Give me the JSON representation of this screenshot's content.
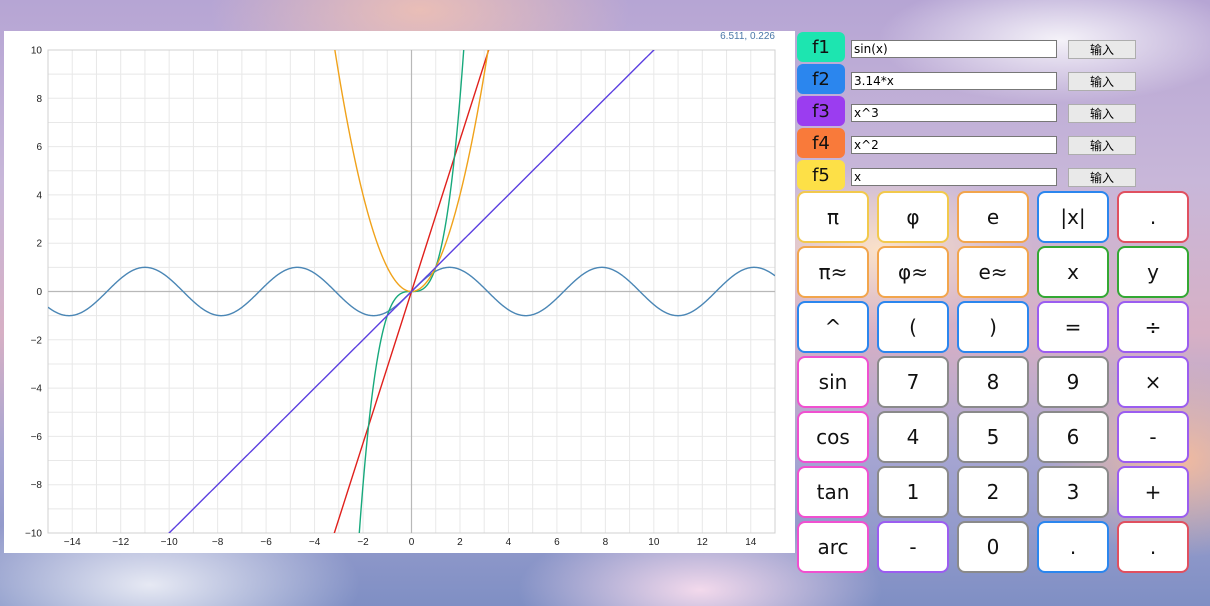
{
  "plot": {
    "coord_readout": "6.511, 0.226",
    "x_tick_labels": [
      "−14",
      "−12",
      "−10",
      "−8",
      "−6",
      "−4",
      "−2",
      "0",
      "2",
      "4",
      "6",
      "8",
      "10",
      "12",
      "14"
    ],
    "y_tick_labels": [
      "10",
      "8",
      "6",
      "4",
      "2",
      "0",
      "−2",
      "−4",
      "−6",
      "−8",
      "−10"
    ]
  },
  "chart_data": {
    "type": "line",
    "xlim": [
      -15,
      15
    ],
    "ylim": [
      -10,
      10
    ],
    "grid": true,
    "series": [
      {
        "expr": "sin(x)",
        "color": "#4a86b5"
      },
      {
        "expr": "3.14*x",
        "color": "#e0201c"
      },
      {
        "expr": "x^3",
        "color": "#17a97c"
      },
      {
        "expr": "x^2",
        "color": "#f0a21a"
      },
      {
        "expr": "x",
        "color": "#5b3fe0"
      }
    ]
  },
  "functions": [
    {
      "label": "f1",
      "value": "sin(x)",
      "button": "输入",
      "color": "#1de5b0"
    },
    {
      "label": "f2",
      "value": "3.14*x",
      "button": "输入",
      "color": "#2b86ee"
    },
    {
      "label": "f3",
      "value": "x^3",
      "button": "输入",
      "color": "#9b3df0"
    },
    {
      "label": "f4",
      "value": "x^2",
      "button": "输入",
      "color": "#f97a3a"
    },
    {
      "label": "f5",
      "value": "x",
      "button": "输入",
      "color": "#fde047"
    }
  ],
  "keypad": [
    [
      {
        "label": "π",
        "border": "#f2c94c"
      },
      {
        "label": "φ",
        "border": "#f2c94c"
      },
      {
        "label": "e",
        "border": "#f2a54c"
      },
      {
        "label": "|x|",
        "border": "#2b86ee"
      },
      {
        "label": ".",
        "border": "#e05060"
      }
    ],
    [
      {
        "label": "π≈",
        "border": "#f2a54c"
      },
      {
        "label": "φ≈",
        "border": "#f2a54c"
      },
      {
        "label": "e≈",
        "border": "#f2a54c"
      },
      {
        "label": "x",
        "border": "#33a833"
      },
      {
        "label": "y",
        "border": "#33a833"
      }
    ],
    [
      {
        "label": "^",
        "border": "#2b86ee"
      },
      {
        "label": "(",
        "border": "#2b86ee"
      },
      {
        "label": ")",
        "border": "#2b86ee"
      },
      {
        "label": "=",
        "border": "#9b5df0"
      },
      {
        "label": "÷",
        "border": "#9b5df0"
      }
    ],
    [
      {
        "label": "sin",
        "border": "#f050d0"
      },
      {
        "label": "7",
        "border": "#8a8a8a"
      },
      {
        "label": "8",
        "border": "#8a8a8a"
      },
      {
        "label": "9",
        "border": "#8a8a8a"
      },
      {
        "label": "×",
        "border": "#9b5df0"
      }
    ],
    [
      {
        "label": "cos",
        "border": "#f050d0"
      },
      {
        "label": "4",
        "border": "#8a8a8a"
      },
      {
        "label": "5",
        "border": "#8a8a8a"
      },
      {
        "label": "6",
        "border": "#8a8a8a"
      },
      {
        "label": "-",
        "border": "#9b5df0"
      }
    ],
    [
      {
        "label": "tan",
        "border": "#f050d0"
      },
      {
        "label": "1",
        "border": "#8a8a8a"
      },
      {
        "label": "2",
        "border": "#8a8a8a"
      },
      {
        "label": "3",
        "border": "#8a8a8a"
      },
      {
        "label": "+",
        "border": "#9b5df0"
      }
    ],
    [
      {
        "label": "arc",
        "border": "#f050d0"
      },
      {
        "label": "-",
        "border": "#9b5df0"
      },
      {
        "label": "0",
        "border": "#8a8a8a"
      },
      {
        "label": ".",
        "border": "#2b86ee"
      },
      {
        "label": ".",
        "border": "#e05060"
      }
    ]
  ]
}
